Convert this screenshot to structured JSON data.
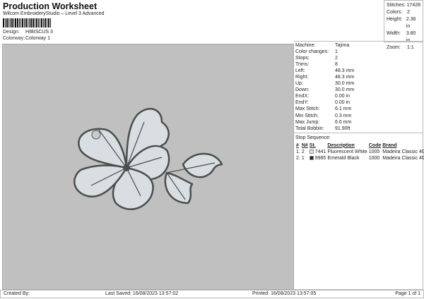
{
  "header": {
    "title": "Production Worksheet",
    "subtitle": "Wilcom EmbroideryStudio – Level 3 Advanced",
    "design_label": "Design:",
    "design_value": "HIBISCUS 3",
    "colorway_label": "Colorway:",
    "colorway_value": "Colorway 1"
  },
  "stats": [
    {
      "k": "Stitches:",
      "v": "17428"
    },
    {
      "k": "Colors:",
      "v": "2"
    },
    {
      "k": "Height:",
      "v": "2.36 in"
    },
    {
      "k": "Width:",
      "v": "3.80 in"
    },
    {
      "k": "Zoom:",
      "v": "1:1"
    }
  ],
  "info": [
    {
      "k": "Machine:",
      "v": "Tajima"
    },
    {
      "k": "Color changes:",
      "v": "1"
    },
    {
      "k": "Stops:",
      "v": "2"
    },
    {
      "k": "Trims:",
      "v": "8"
    },
    {
      "k": "Left:",
      "v": "48.3 mm"
    },
    {
      "k": "Right:",
      "v": "48.3 mm"
    },
    {
      "k": "Up:",
      "v": "30.0 mm"
    },
    {
      "k": "Down:",
      "v": "30.0 mm"
    },
    {
      "k": "EndX:",
      "v": "0.00 in"
    },
    {
      "k": "EndY:",
      "v": "0.00 in"
    },
    {
      "k": "Max Stitch:",
      "v": "6.1 mm"
    },
    {
      "k": "Min Stitch:",
      "v": "0.3 mm"
    },
    {
      "k": "Max Jump:",
      "v": "6.6 mm"
    },
    {
      "k": "Total Bobbin:",
      "v": "91.90ft"
    }
  ],
  "stop_sequence": {
    "title": "Stop Sequence:",
    "headers": [
      "#",
      "N#",
      "St.",
      "Description",
      "Code",
      "Brand"
    ],
    "rows": [
      {
        "n": "1.",
        "nn": "2",
        "color": "#dde4ee",
        "st": "7441",
        "desc": "Fluorescent White",
        "code": "1005",
        "brand": "Madeira Classic 40"
      },
      {
        "n": "2.",
        "nn": "1",
        "color": "#222222",
        "st": "9985",
        "desc": "Emerald Black",
        "code": "1000",
        "brand": "Madeira Classic 40"
      }
    ]
  },
  "footer": {
    "created": "Created By:",
    "saved": "Last Saved: 16/08/2023 13:57:02",
    "printed": "Printed: 16/08/2023 13:57:05",
    "page": "Page 1 of 1"
  }
}
